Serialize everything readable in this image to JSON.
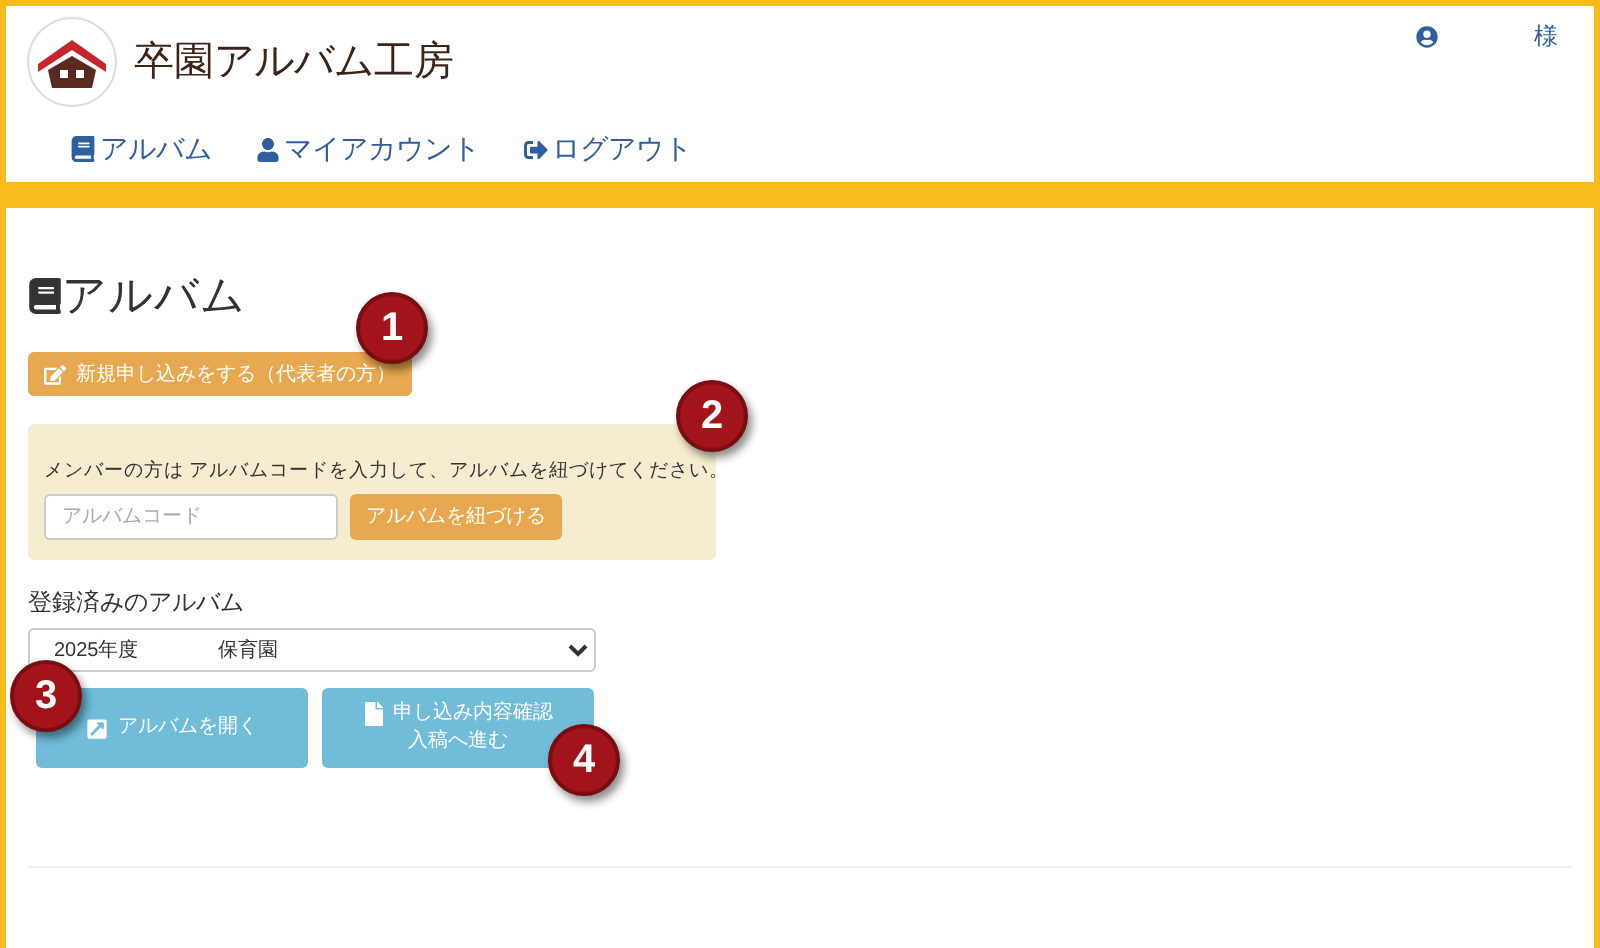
{
  "header": {
    "site_title": "卒園アルバム工房",
    "user_suffix": "様",
    "nav": [
      {
        "label": "アルバム",
        "kind": "book"
      },
      {
        "label": "マイアカウント",
        "kind": "user"
      },
      {
        "label": "ログアウト",
        "kind": "logout"
      }
    ]
  },
  "page_title": "アルバム",
  "new_application_button": "新規申し込みをする（代表者の方）",
  "member_panel": {
    "message": "メンバーの方は アルバムコードを入力して、アルバムを紐づけてください。",
    "code_field": {
      "placeholder": "アルバムコード"
    },
    "link_button": "アルバムを紐づける"
  },
  "registered_albums": {
    "label": "登録済みのアルバム",
    "selected_value": "2025年度　　　　保育園"
  },
  "actions": [
    {
      "kind": "open",
      "lines": [
        "アルバムを開く"
      ]
    },
    {
      "kind": "confirm",
      "lines": [
        "申し込み内容確認",
        "入稿へ進む"
      ]
    }
  ],
  "callouts": [
    "1",
    "2",
    "3",
    "4"
  ]
}
